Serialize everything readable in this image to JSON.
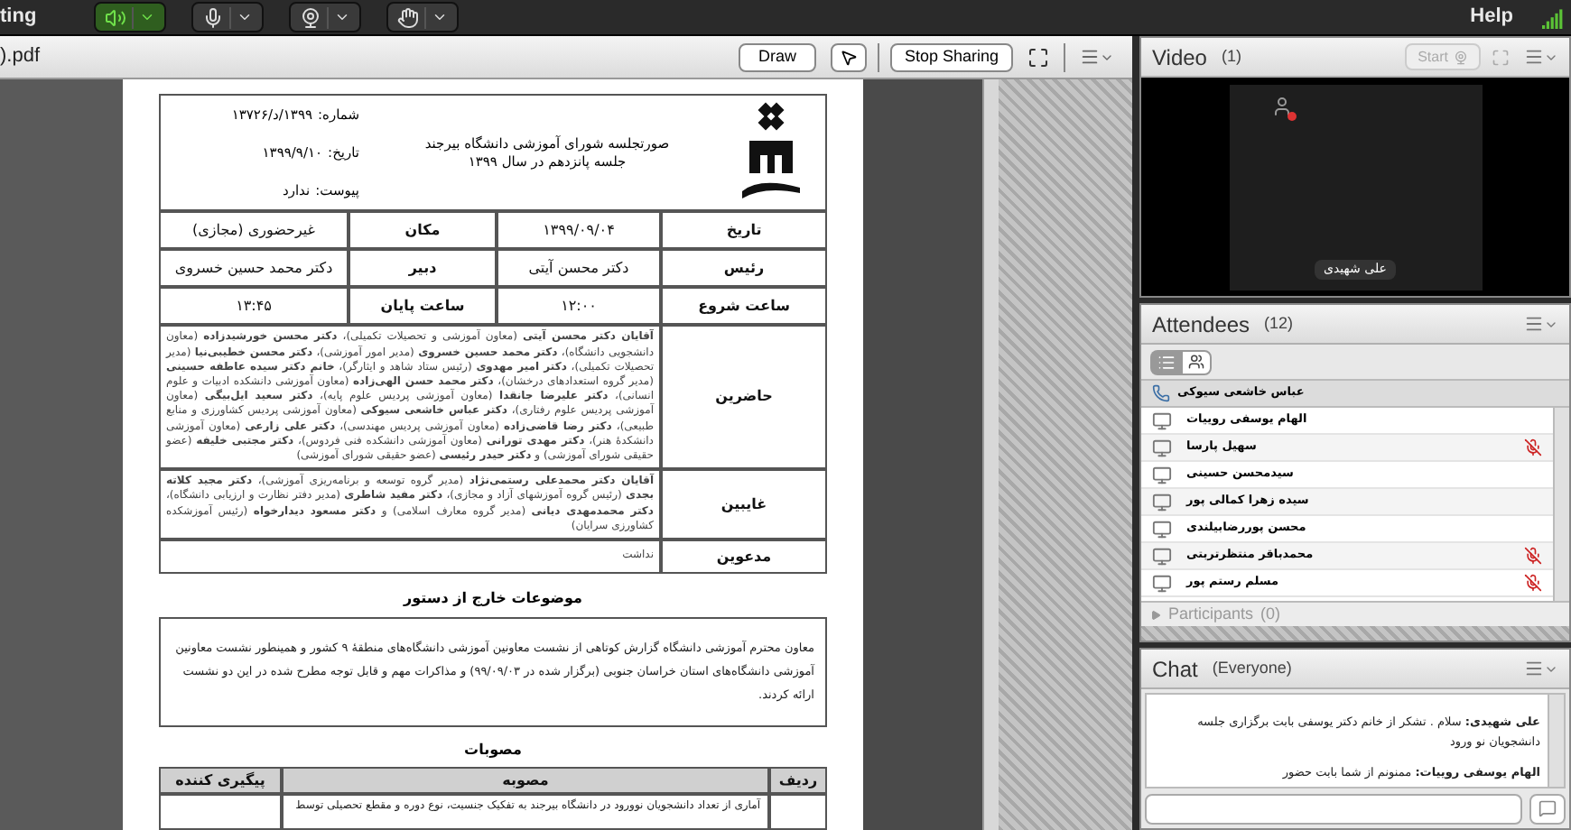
{
  "top_bar": {
    "title": "ting",
    "tools": [
      {
        "kind": "speaker",
        "on": true
      },
      {
        "kind": "mic",
        "on": false
      },
      {
        "kind": "camera",
        "on": false
      },
      {
        "kind": "hand",
        "on": false
      }
    ],
    "help": "Help"
  },
  "share_pod": {
    "title": ").pdf",
    "draw_button": "Draw",
    "stop_button": "Stop Sharing"
  },
  "document": {
    "header": {
      "fields": [
        {
          "label": "شماره:",
          "value": "۱۳۹۹/د/۱۳۷۲۶"
        },
        {
          "label": "تاریخ:",
          "value": "۱۳۹۹/۹/۱۰"
        },
        {
          "label": "پیوست:",
          "value": "ندارد"
        }
      ],
      "title": [
        "صورتجلسه شورای آموزشی دانشگاه بیرجند",
        "جلسه پانزدهم در سال ۱۳۹۹"
      ]
    },
    "info_rows": [
      [
        "تاریخ",
        "۱۳۹۹/۰۹/۰۴",
        "مکان",
        "غیرحضوری (مجازی)"
      ],
      [
        "رئیس",
        "دکتر محسن آیتی",
        "دبیر",
        "دکتر محمد حسین خسروی"
      ],
      [
        "ساعت شروع",
        "۱۲:۰۰",
        "ساعت پایان",
        "۱۳:۴۵"
      ]
    ],
    "list_rows": [
      {
        "label": "حاضرین",
        "text": "**آقایان دکتر محسن آیتی** (معاون آموزشی و تحصیلات تکمیلی)، **دکتر محسن خورشیدزاده** (معاون دانشجویی دانشگاه)، **دکتر محمد حسین خسروی** (مدیر امور آموزشی)، **دکتر محسن خطیبی‌نیا** (مدیر تحصیلات تکمیلی)، **دکتر امیر مهدوی** (رئیس ستاد شاهد و ایثارگر)، **خانم دکتر سیده عاطفه حسینی** (مدیر گروه استعدادهای درخشان)، **دکتر محمد حسن الهی‌زاده** (معاون آموزشی دانشکده ادبیات و علوم انسانی)، **دکتر علیرضا جانقدا** (معاون آموزشی پردیس علوم پایه)، **دکتر سعید ایل‌بیگی** (معاون آموزشی پردیس علوم رفتاری)، **دکتر عباس خاشعی سیوکی** (معاون آموزشی پردیس کشاورزی و منابع طبیعی)، **دکتر رضا قاضی‌زاده** (معاون آموزشی پردیس مهندسی)، **دکتر علی زارعی** (معاون آموزشی دانشکدهٔ هنر)، **دکتر مهدی تورانی** (معاون آموزشی دانشکده فنی فردوس)، **دکتر مجتبی خلیفه** (عضو حقیقی شورای آموزشی) و **دکتر حیدر رئیسی** (عضو حقیقی شورای آموزشی)"
      },
      {
        "label": "غایبین",
        "text": "**آقایان دکتر محمدعلی رستمی‌نژاد** (مدیر گروه توسعه و برنامه‌ریزی آموزشی)، **دکتر مجید کلاته بجدی** (رئیس گروه آموزشهای آزاد و مجازی)، **دکتر مفید شاطری** (مدیر دفتر نظارت و ارزیابی دانشگاه)، **دکتر محمدمهدی دیانی** (مدیر گروه معارف اسلامی) و **دکتر مسعود دیدارخواه** (رئیس آموزشکده کشاورزی سرایان)"
      },
      {
        "label": "مدعوین",
        "text": "نداشت"
      }
    ],
    "section_title": "موضوعات خارج از دستور",
    "section_text": "معاون محترم آموزشی دانشگاه گزارش کوتاهی از نشست معاونین آموزشی دانشگاه‌های منطقهٔ ۹ کشور و همینطور نشست معاونین آموزشی دانشگاه‌های استان خراسان جنوبی (برگزار شده در ۹۹/۰۹/۰۳) و مذاکرات مهم و قابل توجه مطرح شده در این دو نشست ارائه کردند.",
    "resolutions_title": "مصوبات",
    "resolutions_table": {
      "columns": [
        "ردیف",
        "مصوبه",
        "پیگیری کننده"
      ],
      "rows": [
        {
          "text": "آماری از تعداد دانشجویان نوورود در دانشگاه بیرجند به تفکیک جنسیت، نوع دوره و مقطع تحصیلی توسط"
        }
      ]
    }
  },
  "video_pod": {
    "title": "Video",
    "count": "(1)",
    "start_button": {
      "label": "Start",
      "disabled": true
    },
    "video": {
      "name": "علی شهیدی"
    }
  },
  "attendees_pod": {
    "title": "Attendees",
    "count": "(12)",
    "presenter": {
      "name": "عباس خاشعی سیوکی"
    },
    "items": [
      {
        "name": "الهام یوسفی روییات",
        "mic_muted": false
      },
      {
        "name": "سهیل پارسا",
        "mic_muted": true
      },
      {
        "name": "سیدمحسن حسینی",
        "mic_muted": false
      },
      {
        "name": "سیده زهرا کمالی پور",
        "mic_muted": false
      },
      {
        "name": "محسن پوررضابیلندی",
        "mic_muted": false
      },
      {
        "name": "محمدباقر منتظرتربتی",
        "mic_muted": true
      },
      {
        "name": "مسلم رستم پور",
        "mic_muted": true
      }
    ],
    "participants": {
      "label": "Participants",
      "count": "(0)",
      "expanded": false
    }
  },
  "chat_pod": {
    "title": "Chat",
    "audience": "(Everyone)",
    "messages": [
      "**علی شهیدی:** سلام . تشکر از خانم دکتر یوسفی بابت برگزاری جلسه دانشجویان نو ورود",
      "**الهام یوسفی روییات:** ممنونم از شما بابت حضور"
    ]
  }
}
